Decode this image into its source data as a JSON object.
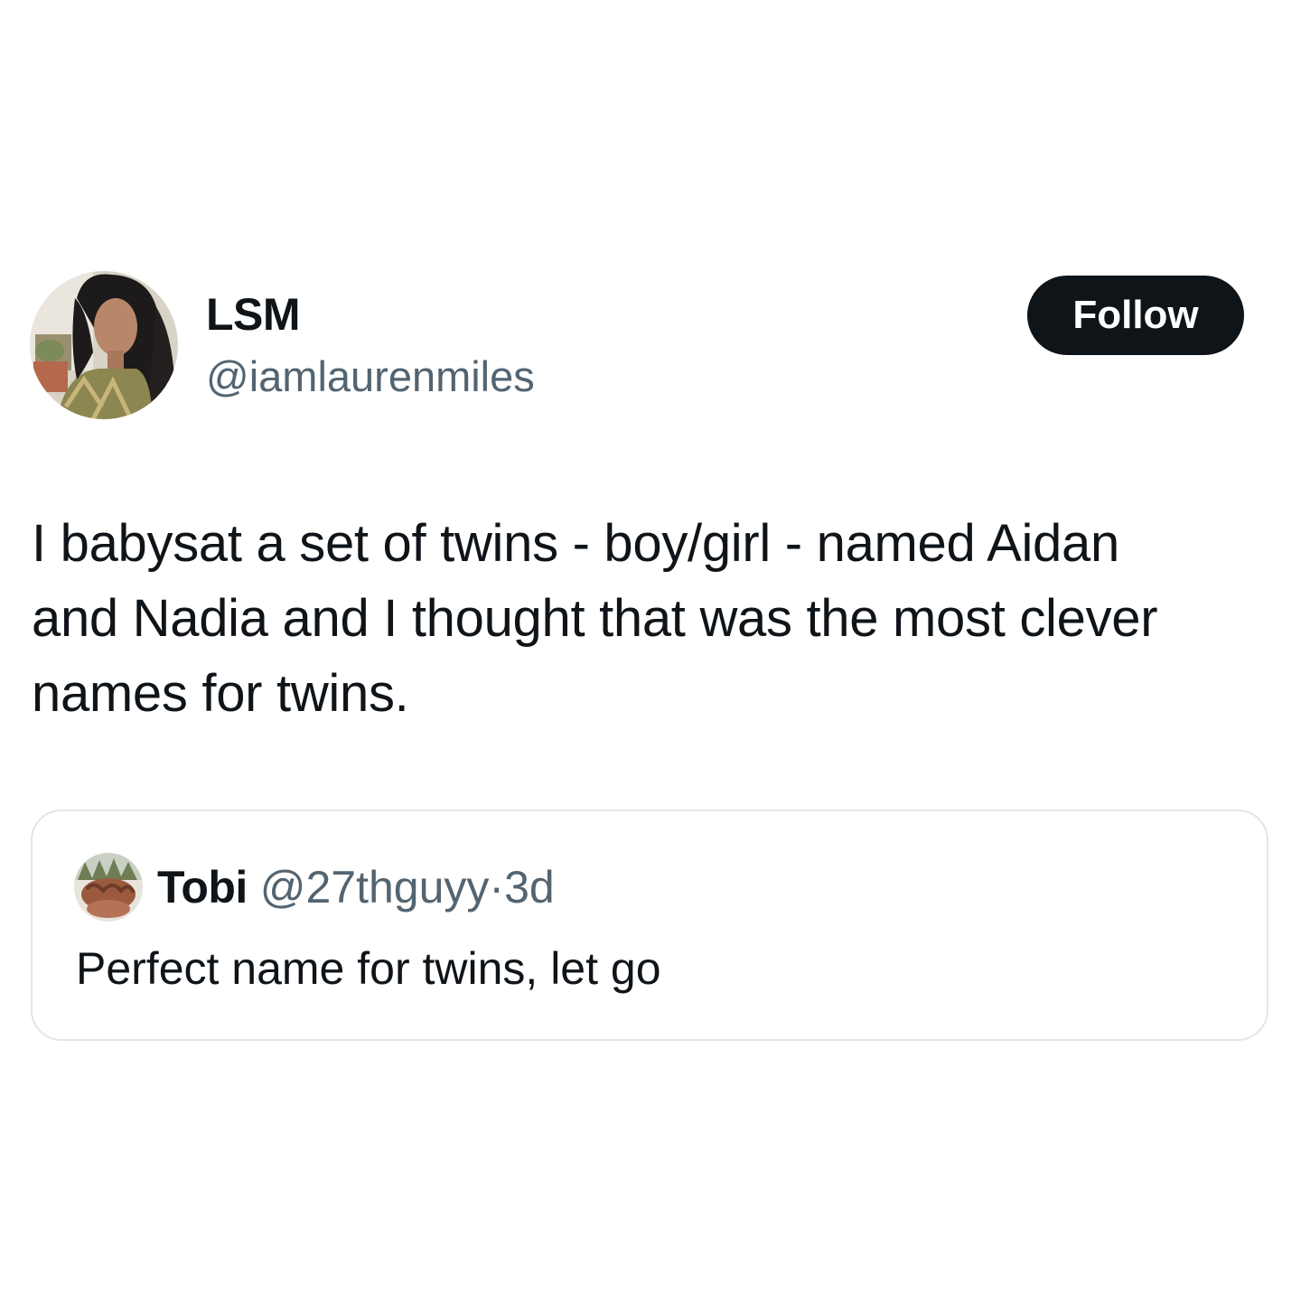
{
  "post": {
    "author": {
      "display_name": "LSM",
      "handle": "@iamlaurenmiles",
      "avatar": "profile-photo"
    },
    "follow_label": "Follow",
    "text_lines": [
      "I babysat a set of twins - boy/girl - named Aidan",
      "and Nadia and I thought that was the most clever",
      "names for twins."
    ],
    "quote": {
      "avatar": "profile-photo",
      "display_name": "Tobi",
      "handle": "@27thguyy",
      "separator": "·",
      "time": "3d",
      "text": "Perfect name for twins, let go"
    }
  },
  "colors": {
    "text_primary": "#0f1419",
    "text_secondary": "#536471",
    "button_bg": "#0f1419",
    "button_text": "#ffffff",
    "card_border": "#e1e6ea",
    "background": "#ffffff"
  }
}
